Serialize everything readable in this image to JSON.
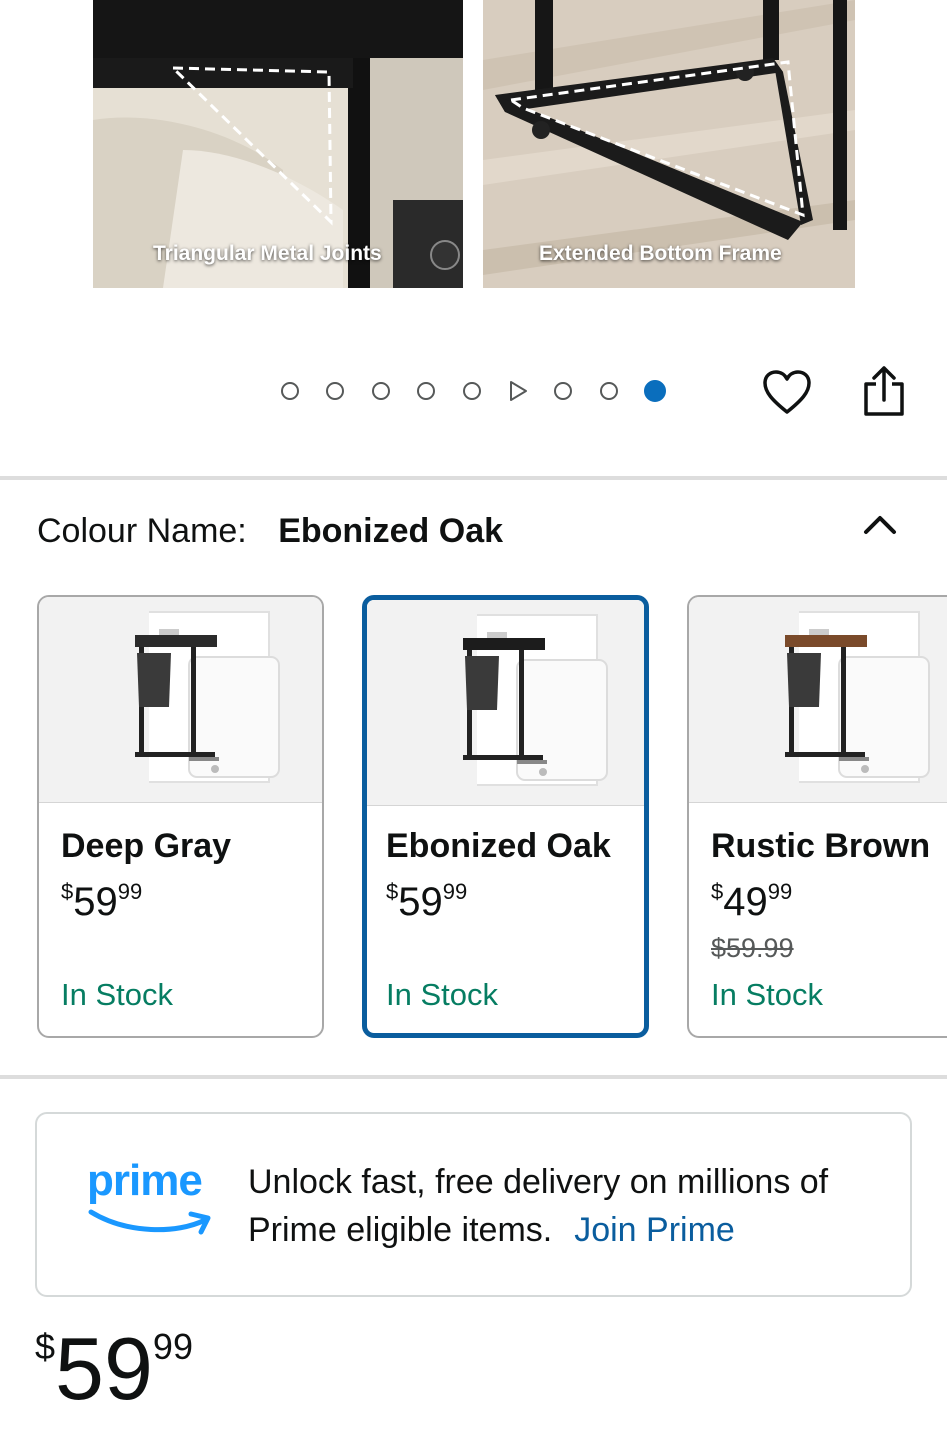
{
  "gallery": {
    "images": [
      {
        "caption": "Triangular Metal Joints"
      },
      {
        "caption": "Extended Bottom Frame"
      }
    ],
    "dots": {
      "count_before_video": 5,
      "count_after_video": 2,
      "active_index": 8
    }
  },
  "actions": {
    "favorite_icon": "heart-icon",
    "share_icon": "share-icon"
  },
  "colour": {
    "label": "Colour Name:",
    "selected": "Ebonized Oak",
    "collapse_icon": "chevron-up-icon",
    "options": [
      {
        "name": "Deep Gray",
        "currency": "$",
        "whole": "59",
        "fraction": "99",
        "was": "",
        "stock": "In Stock",
        "top_color": "#2b2b2b"
      },
      {
        "name": "Ebonized Oak",
        "currency": "$",
        "whole": "59",
        "fraction": "99",
        "was": "",
        "stock": "In Stock",
        "top_color": "#1c1c1c"
      },
      {
        "name": "Rustic Brown",
        "currency": "$",
        "whole": "49",
        "fraction": "99",
        "was": "$59.99",
        "stock": "In Stock",
        "top_color": "#7a4a2a"
      }
    ]
  },
  "prime": {
    "logo": "prime",
    "message": "Unlock fast, free delivery on millions of Prime eligible items.",
    "link": "Join Prime"
  },
  "price": {
    "currency": "$",
    "whole": "59",
    "fraction": "99"
  },
  "colors": {
    "accent": "#0a5d9e",
    "stock": "#067d62",
    "prime": "#1a98ff",
    "dot_active": "#0a6ebd"
  }
}
